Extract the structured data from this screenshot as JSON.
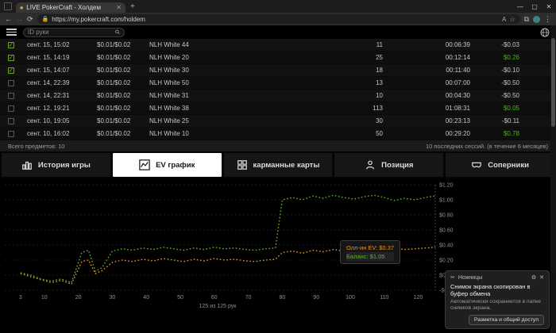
{
  "browser": {
    "tab_title": "LIVE PokerCraft - Холдем",
    "url": "https://my.pokercraft.com/holdem"
  },
  "topbar": {
    "search_placeholder": "ID руки"
  },
  "sessions": {
    "rows": [
      {
        "checked": true,
        "date": "сент. 15, 15:02",
        "stakes": "$0.01/$0.02",
        "game": "NLH White 44",
        "hands": "11",
        "duration": "00:06:39",
        "result": "-$0.03"
      },
      {
        "checked": true,
        "date": "сент. 15, 14:19",
        "stakes": "$0.01/$0.02",
        "game": "NLH White 20",
        "hands": "25",
        "duration": "00:12:14",
        "result": "$0.26"
      },
      {
        "checked": true,
        "date": "сент. 15, 14:07",
        "stakes": "$0.01/$0.02",
        "game": "NLH White 30",
        "hands": "18",
        "duration": "00:11:40",
        "result": "-$0.10"
      },
      {
        "checked": false,
        "date": "сент. 14, 22:39",
        "stakes": "$0.01/$0.02",
        "game": "NLH White 50",
        "hands": "13",
        "duration": "00:07:00",
        "result": "-$0.50"
      },
      {
        "checked": false,
        "date": "сент. 14, 22:31",
        "stakes": "$0.01/$0.02",
        "game": "NLH White 31",
        "hands": "10",
        "duration": "00:04:30",
        "result": "-$0.50"
      },
      {
        "checked": false,
        "date": "сент. 12, 19:21",
        "stakes": "$0.01/$0.02",
        "game": "NLH White 38",
        "hands": "113",
        "duration": "01:08:31",
        "result": "$0.05"
      },
      {
        "checked": false,
        "date": "сент. 10, 19:05",
        "stakes": "$0.01/$0.02",
        "game": "NLH White 25",
        "hands": "30",
        "duration": "00:23:13",
        "result": "-$0.11"
      },
      {
        "checked": false,
        "date": "сент. 10, 16:02",
        "stakes": "$0.01/$0.02",
        "game": "NLH White 10",
        "hands": "50",
        "duration": "00:29:20",
        "result": "$0.78"
      }
    ],
    "footer_left": "Всего предметов: 10",
    "footer_right": "10 последних сессий. (в течение 6 месяцев)"
  },
  "tabs": [
    {
      "label": "История игры"
    },
    {
      "label": "EV график"
    },
    {
      "label": "карманные карты"
    },
    {
      "label": "Позиция"
    },
    {
      "label": "Соперники"
    }
  ],
  "chart_data": {
    "type": "line",
    "x": [
      3,
      6,
      9,
      12,
      15,
      18,
      21,
      23,
      25,
      27,
      30,
      33,
      36,
      39,
      42,
      45,
      48,
      51,
      54,
      57,
      60,
      63,
      66,
      69,
      72,
      75,
      78,
      80,
      83,
      86,
      89,
      92,
      95,
      98,
      101,
      104,
      107,
      110,
      113,
      116,
      119,
      122,
      125
    ],
    "series": [
      {
        "name": "Олл-ин EV",
        "color": "#e0922f",
        "values": [
          0.02,
          -0.02,
          -0.06,
          -0.1,
          -0.07,
          -0.12,
          0.18,
          0.2,
          0.02,
          0.06,
          0.17,
          0.2,
          0.18,
          0.21,
          0.19,
          0.22,
          0.2,
          0.18,
          0.21,
          0.19,
          0.22,
          0.2,
          0.21,
          0.19,
          0.18,
          0.2,
          0.21,
          0.3,
          0.32,
          0.29,
          0.33,
          0.31,
          0.34,
          0.32,
          0.3,
          0.33,
          0.35,
          0.33,
          0.36,
          0.34,
          0.35,
          0.36,
          0.37
        ]
      },
      {
        "name": "Баланс",
        "color": "#63b22c",
        "values": [
          0.03,
          0.0,
          -0.05,
          -0.08,
          -0.05,
          -0.1,
          0.3,
          0.33,
          0.05,
          0.1,
          0.32,
          0.35,
          0.33,
          0.36,
          0.34,
          0.37,
          0.35,
          0.33,
          0.36,
          0.34,
          0.37,
          0.35,
          0.36,
          0.34,
          0.33,
          0.35,
          0.36,
          1.0,
          1.03,
          1.0,
          1.05,
          1.02,
          1.06,
          1.03,
          1.01,
          1.04,
          1.06,
          1.03,
          0.99,
          1.02,
          1.0,
          1.03,
          1.05
        ]
      }
    ],
    "xticks": [
      3,
      10,
      20,
      30,
      40,
      50,
      60,
      70,
      80,
      90,
      100,
      110,
      120
    ],
    "xmax": 125,
    "ylim": [
      -0.2,
      1.2
    ],
    "ytick_step": 0.2,
    "grid": true,
    "legend_position": "bottom-right",
    "caption": "125 из 125 рук"
  },
  "tooltip": {
    "ev": "Олл-ин EV: $0.37",
    "balance": "Баланс: $1.05"
  },
  "toast": {
    "app": "Ножницы",
    "line1": "Снимок экрана скопирован в буфер обмена",
    "line2": "Автоматически сохраняется в папке снимков экрана.",
    "button": "Разметка и общий доступ"
  }
}
